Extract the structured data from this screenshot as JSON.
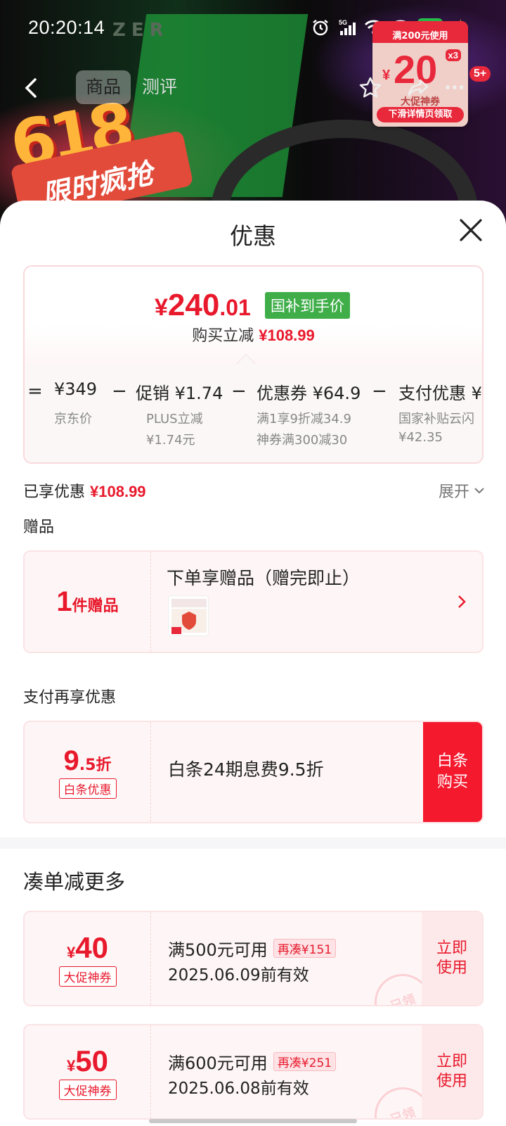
{
  "status_bar": {
    "time": "20:20:14",
    "network": "5G",
    "battery": "87"
  },
  "background": {
    "brand": "ZER",
    "promo_text": "618",
    "banner_text": "限时疯抢",
    "tabs": {
      "goods": "商品",
      "review": "测评"
    },
    "notification_badge": "5+",
    "promo_card": {
      "top": "满200元使用",
      "yen": "¥",
      "amount": "20",
      "multiplier": "x3",
      "label": "大促神券",
      "button": "下滑详情页领取"
    }
  },
  "sheet": {
    "title": "优惠",
    "price_card": {
      "final_price_yen": "¥",
      "final_price_int": "240",
      "final_price_dec": ".01",
      "subsidy_tag": "国补到手价",
      "reduce_label": "购买立减",
      "reduce_amount": "¥108.99",
      "breakdown": [
        {
          "op": "=",
          "main": "¥349",
          "sub": "京东价",
          "sub2": ""
        },
        {
          "op": "−",
          "main": "促销 ¥1.74",
          "sub": "PLUS立减",
          "sub2": "¥1.74元"
        },
        {
          "op": "−",
          "main": "优惠券 ¥64.9",
          "sub": "满1享9折减34.9",
          "sub2": "神券满300减30"
        },
        {
          "op": "−",
          "main": "支付优惠 ¥",
          "sub": "国家补贴云闪",
          "sub2": "¥42.35"
        }
      ]
    },
    "enjoyed_label": "已享优惠",
    "enjoyed_amount": "¥108.99",
    "expand_label": "展开",
    "gift_section_label": "赠品",
    "gift": {
      "count": "1",
      "count_unit": "件赠品",
      "title": "下单享赠品（赠完即止）"
    },
    "pay_section_label": "支付再享优惠",
    "pay": {
      "discount_big": "9",
      "discount_small": ".5折",
      "tag": "白条优惠",
      "title": "白条24期息费9.5折",
      "button": "白条\n购买"
    },
    "more_title": "凑单减更多",
    "coupons": [
      {
        "yen": "¥",
        "amount": "40",
        "tag": "大促神券",
        "condition": "满500元可用",
        "extra": "再凑¥151",
        "valid": "2025.06.09前有效",
        "button": "立即\n使用",
        "stamp": "已领"
      },
      {
        "yen": "¥",
        "amount": "50",
        "tag": "大促神券",
        "condition": "满600元可用",
        "extra": "再凑¥251",
        "valid": "2025.06.08前有效",
        "button": "立即\n使用",
        "stamp": "已领"
      }
    ]
  },
  "colors": {
    "accent_red": "#e8192c",
    "subsidy_green": "#3fae49",
    "card_bg": "#fef6f6"
  }
}
